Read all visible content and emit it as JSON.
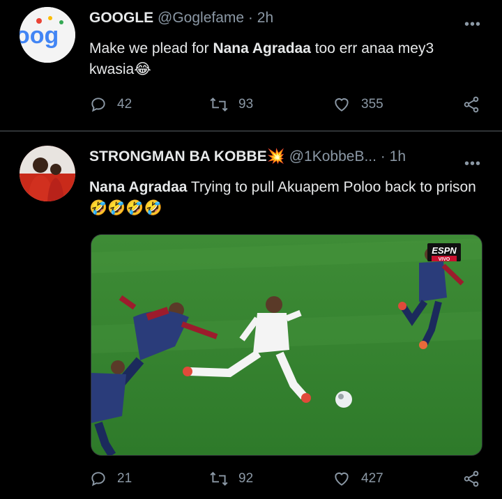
{
  "tweets": [
    {
      "name": "GOOGLE",
      "handle": "@Goglefame",
      "time": "2h",
      "text_plain": "Make we plead for ",
      "text_bold": "Nana Agradaa",
      "text_rest": " too err anaa mey3 kwasia",
      "emoji": "😂",
      "replies": "42",
      "retweets": "93",
      "likes": "355",
      "avatar_text": "oog"
    },
    {
      "name": "STRONGMAN BA KOBBE",
      "name_emoji": "💥",
      "handle": "@1KobbeB...",
      "time": "1h",
      "text_bold": "Nana Agradaa",
      "text_rest": " Trying to pull Akuapem Poloo back to prison",
      "emoji": "🤣🤣🤣🤣",
      "replies": "21",
      "retweets": "92",
      "likes": "427",
      "media_badge": "ESPN",
      "media_badge_sub": "VIVO"
    }
  ],
  "separator": "·",
  "colors": {
    "background": "#000000",
    "text": "#e7e9ea",
    "muted": "#8b98a5",
    "divider": "#2f3336",
    "pitch": "#3a8534"
  }
}
